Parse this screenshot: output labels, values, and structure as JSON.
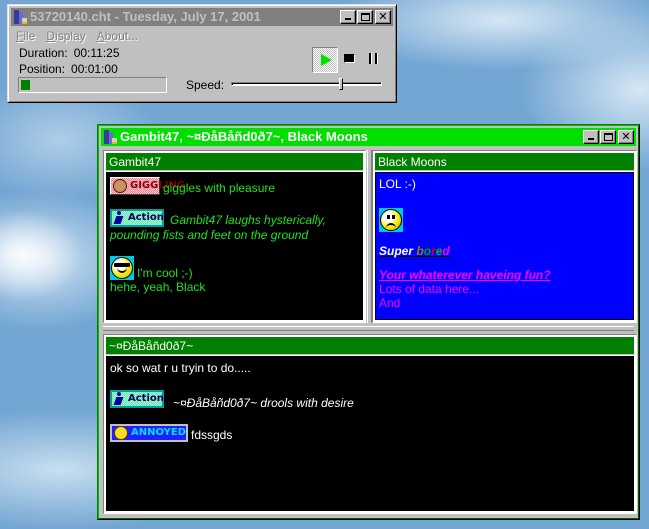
{
  "player": {
    "title": "53720140.cht - Tuesday, July 17, 2001",
    "menu": [
      {
        "label": "File",
        "accel": "F",
        "rest": "ile"
      },
      {
        "label": "Display",
        "accel": "D",
        "rest": "isplay"
      },
      {
        "label": "About...",
        "accel": "A",
        "rest": "bout..."
      }
    ],
    "duration_label": "Duration:",
    "duration_value": "00:11:25",
    "position_label": "Position:",
    "position_value": "00:01:00",
    "progress_fraction": 0.088,
    "speed_label": "Speed:",
    "speed_fraction": 0.75,
    "controls": [
      "play",
      "stop",
      "pause"
    ],
    "icons": {
      "play": "play-icon",
      "stop": "stop-icon",
      "pause": "pause-icon"
    }
  },
  "chat": {
    "title": "Gambit47, ~¤ÐåBåñd0ð7~, Black Moons",
    "colors": {
      "title_bar": "#00e000",
      "pane_header": "#008000",
      "left_bg": "#000000",
      "right_bg": "#0000ff",
      "bottom_bg": "#000000"
    },
    "panes": {
      "left": {
        "header": "Gambit47",
        "messages": [
          {
            "badge": "GIGGLING",
            "text": "giggles with pleasure"
          },
          {
            "badge": "Action",
            "text": "Gambit47 laughs hysterically, pounding fists and feet on the ground"
          },
          {
            "emoticon": "cool-smiley",
            "text": "I'm cool ;-)"
          },
          {
            "text": "hehe, yeah, Black"
          }
        ]
      },
      "right": {
        "header": "Black Moons",
        "messages": [
          {
            "text": "LOL :-)"
          },
          {
            "emoticon": "sad-smiley"
          },
          {
            "text_part1": "Super ",
            "colored_word": [
              "b",
              "o",
              "r",
              "e",
              "d"
            ]
          },
          {
            "text": "Your whaterever haveing fun?"
          },
          {
            "text": "Lots of data here..."
          },
          {
            "text": "And"
          }
        ]
      },
      "bottom": {
        "header": "~¤ÐåBåñd0ð7~",
        "messages": [
          {
            "text": "ok so wat r u tryin to do....."
          },
          {
            "badge": "Action",
            "text": "~¤ÐåBåñd0ð7~ drools with desire"
          },
          {
            "badge": "ANNOYED",
            "text": "fdssgds"
          }
        ]
      }
    }
  }
}
